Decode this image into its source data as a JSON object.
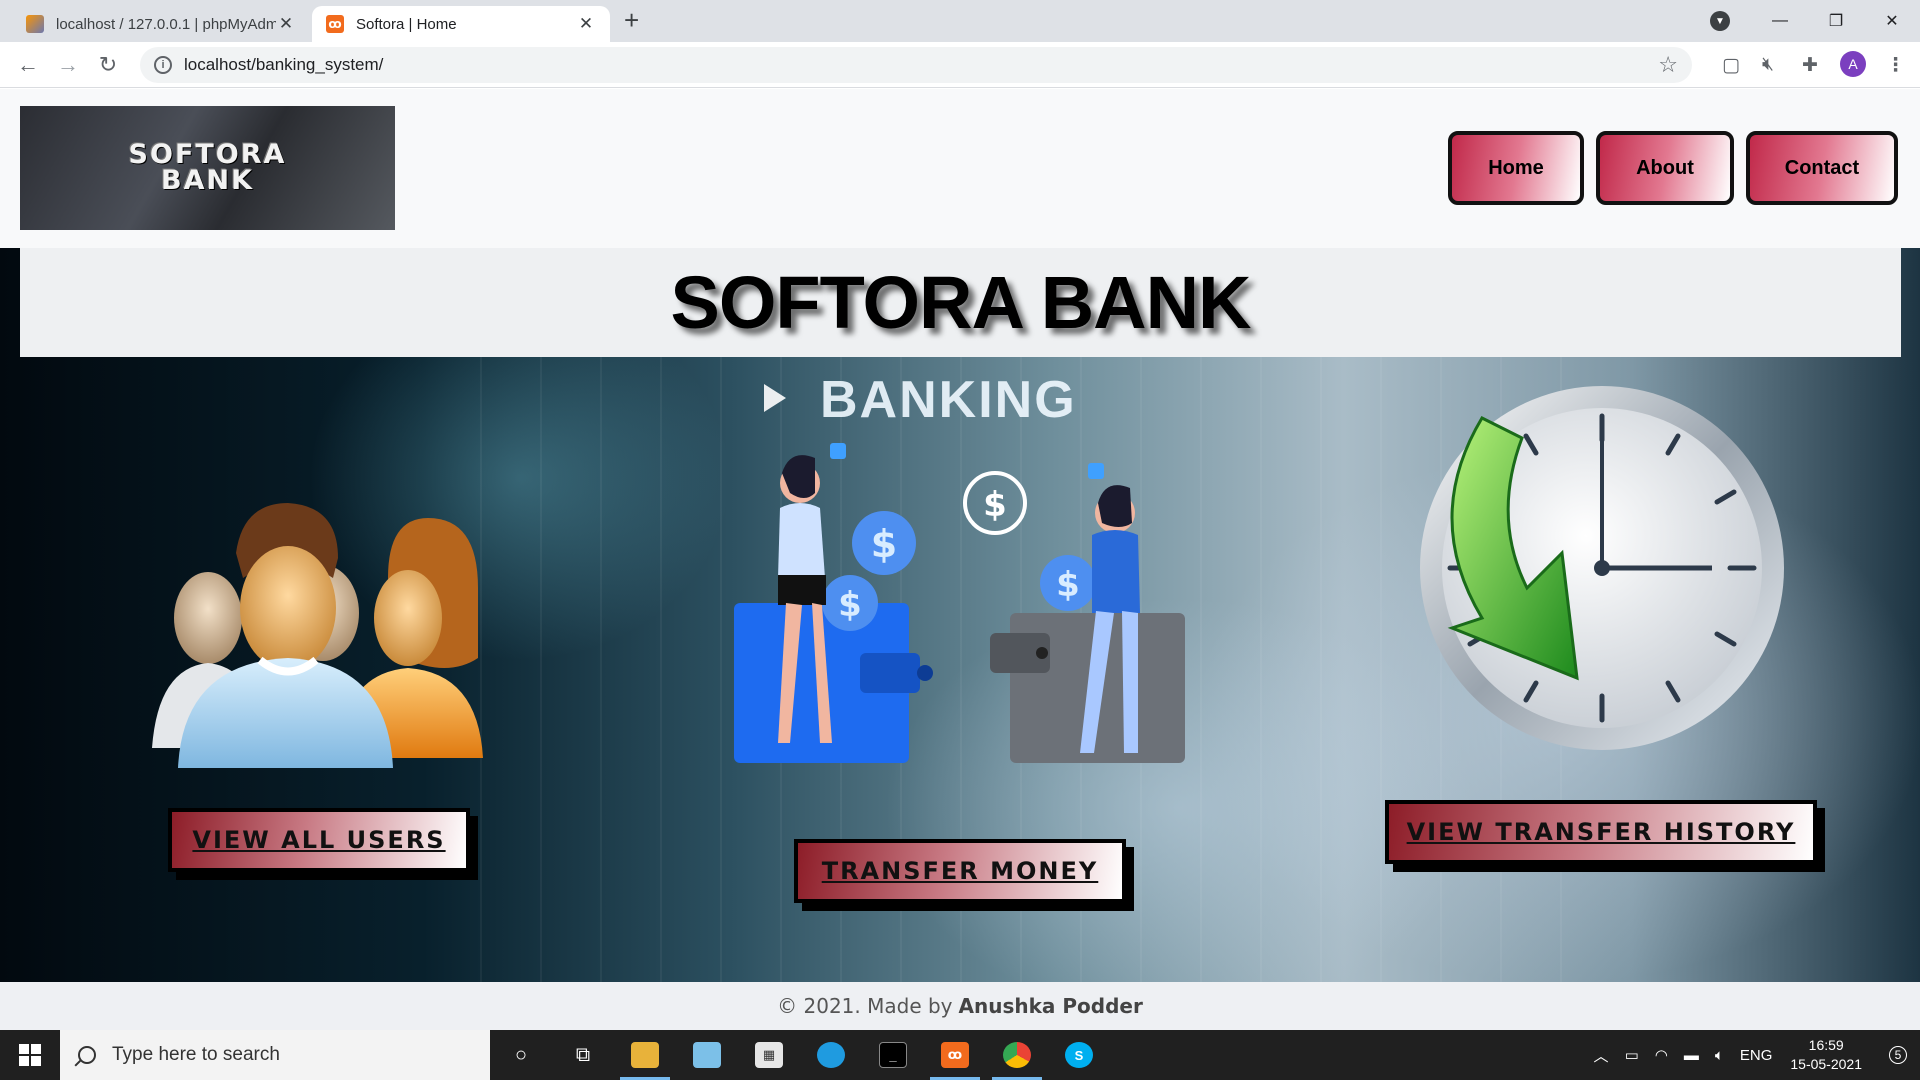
{
  "browser": {
    "tabs": [
      {
        "title": "localhost / 127.0.0.1 | phpMyAdm",
        "active": false,
        "favicon": "phpmyadmin-icon"
      },
      {
        "title": "Softora | Home",
        "active": true,
        "favicon": "xampp-icon"
      }
    ],
    "url": "localhost/banking_system/",
    "avatar_initial": "A"
  },
  "header": {
    "logo_line1": "SOFTORA",
    "logo_line2": "BANK",
    "nav": [
      {
        "label": "Home"
      },
      {
        "label": "About"
      },
      {
        "label": "Contact"
      }
    ]
  },
  "hero": {
    "title": "SOFTORA BANK",
    "background_text": "BANKING",
    "actions": {
      "view_users": "VIEW ALL USERS",
      "transfer_money": "TRANSFER MONEY",
      "view_history": "VIEW TRANSFER HISTORY"
    }
  },
  "footer": {
    "prefix": "© 2021. Made by",
    "author": "Anushka Podder"
  },
  "taskbar": {
    "search_placeholder": "Type here to search",
    "language": "ENG",
    "time": "16:59",
    "date": "15-05-2021",
    "notification_count": "5"
  },
  "colors": {
    "nav_gradient_start": "#c1294a",
    "cta_gradient_start": "#8d1d28",
    "header_bg": "#f8f9fa"
  }
}
